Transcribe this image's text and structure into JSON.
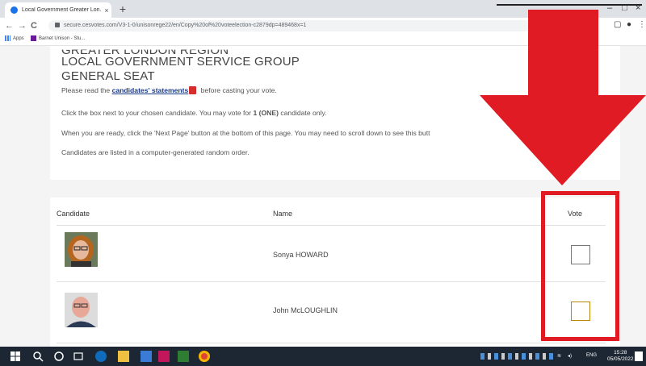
{
  "browser": {
    "tab_title": "Local Government Greater Lon...",
    "new_tab": "+",
    "url": "secure.cesvotes.com/V3-1-0/unisonrege22/en/Copy%20of%20voteelection-c2879dp=489468x=1",
    "bookmarks": [
      {
        "label": "Apps"
      },
      {
        "label": "Barnet Unison - Stu..."
      }
    ],
    "window_controls": {
      "minimize": "–",
      "maximize": "□",
      "close": "×"
    },
    "nav": {
      "back": "←",
      "forward": "→",
      "reload": "C"
    }
  },
  "ballot": {
    "title_partial": "GREATER LONDON REGION",
    "title_line2": "LOCAL GOVERNMENT SERVICE GROUP",
    "title_line3": "GENERAL SEAT",
    "read_prefix": "Please read the ",
    "statements_link": "candidates' statements",
    "read_suffix": " before casting your vote.",
    "instruction_1": "Click the box next to your chosen candidate. You may vote for ",
    "instruction_1_bold": "1 (ONE)",
    "instruction_1_tail": " candidate only.",
    "instruction_2": "When you are ready, click the 'Next Page' button at the bottom of this page.  You may need to scroll down to see this butt",
    "instruction_3": "Candidates are listed in a computer-generated random order.",
    "columns": {
      "candidate": "Candidate",
      "name": "Name",
      "vote": "Vote"
    },
    "candidates": [
      {
        "name": "Sonya HOWARD",
        "checked": false
      },
      {
        "name": "John McLOUGHLIN",
        "checked": false
      }
    ]
  },
  "taskbar": {
    "time": "15:28",
    "date": "05/05/2022",
    "language": "ENG"
  },
  "colors": {
    "annotation_red": "#e01b24",
    "taskbar_bg": "#1c2733",
    "link": "#1a3a8a"
  }
}
